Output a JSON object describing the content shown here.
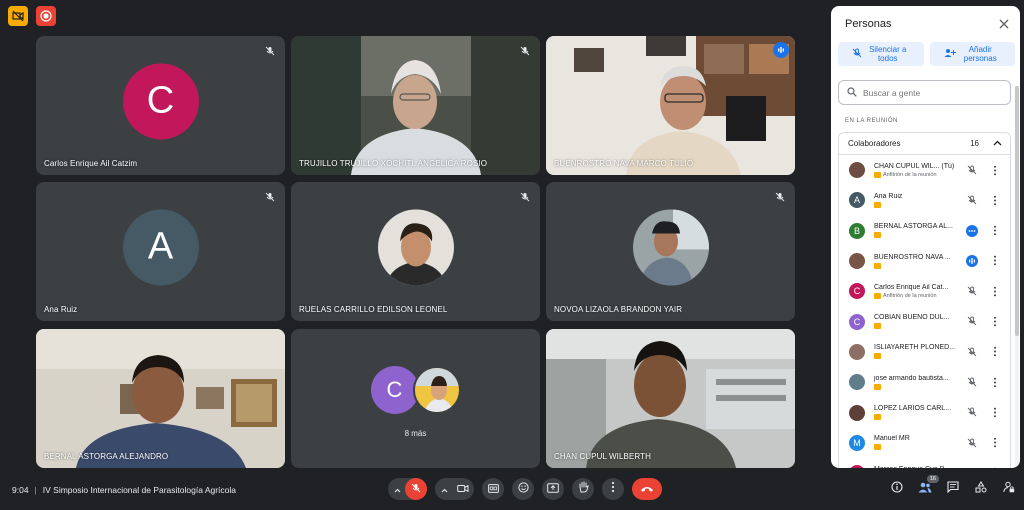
{
  "colors": {
    "accent": "#8ab4f8",
    "danger": "#ea4335",
    "panel_accent": "#1a73e8",
    "tile_bg": "#3c4043"
  },
  "tiles": [
    {
      "name": "Carlos Enrique Ail Catzim",
      "initial": "C",
      "avatar_color": "#c2185b"
    },
    {
      "name": "TRUJILLO TRUJILLO XOCHITL ANGELICA ROSIO"
    },
    {
      "name": "BUENROSTRO NAVA MARCO TULIO"
    },
    {
      "name": "Ana Ruiz",
      "initial": "A",
      "avatar_color": "#455a64"
    },
    {
      "name": "RUELAS CARRILLO EDILSON LEONEL"
    },
    {
      "name": "NOVOA LIZAOLA BRANDON YAIR"
    },
    {
      "name": "BERNAL ASTORGA ALEJANDRO"
    },
    {
      "more_initial": "C",
      "more_label": "8 más"
    },
    {
      "name": "CHAN CUPUL WILBERTH"
    }
  ],
  "panel": {
    "title": "Personas",
    "mute_all": "Silenciar a todos",
    "add_people": "Añadir personas",
    "search_placeholder": "Buscar a gente",
    "section": "EN LA REUNIÓN",
    "group_label": "Colaboradores",
    "group_count": "16",
    "people": [
      {
        "name": "CHAN CUPUL WIL... (Tú)",
        "sub": "Anfitrión de la reunión",
        "initial": "",
        "color": "#6d4c41",
        "status": "muted"
      },
      {
        "name": "Ana Ruiz",
        "sub": "",
        "initial": "A",
        "color": "#455a64",
        "status": "muted"
      },
      {
        "name": "BERNAL ASTORGA AL...",
        "sub": "",
        "initial": "B",
        "color": "#2e7d32",
        "status": "dots"
      },
      {
        "name": "BUENROSTRO NAVA ...",
        "sub": "",
        "initial": "",
        "color": "#795548",
        "status": "speaking"
      },
      {
        "name": "Carlos Enrique Ail Cat...",
        "sub": "Anfitrión de la reunión",
        "initial": "C",
        "color": "#c2185b",
        "status": "muted"
      },
      {
        "name": "COBIAN BUENO DUL...",
        "sub": "",
        "initial": "C",
        "color": "#8e63ce",
        "status": "muted"
      },
      {
        "name": "ISLIAYARETH PLONED...",
        "sub": "",
        "initial": "",
        "color": "#8d6e63",
        "status": "muted"
      },
      {
        "name": "jose armando bautista...",
        "sub": "",
        "initial": "",
        "color": "#607d8b",
        "status": "muted"
      },
      {
        "name": "LOPEZ LARIOS CARL...",
        "sub": "",
        "initial": "",
        "color": "#5d4037",
        "status": "muted"
      },
      {
        "name": "Manuel MR",
        "sub": "",
        "initial": "M",
        "color": "#1e88e5",
        "status": "muted"
      },
      {
        "name": "Marcos Enrique Cua B...",
        "sub": "",
        "initial": "M",
        "color": "#c2185b",
        "status": "muted"
      }
    ]
  },
  "bottom": {
    "time": "9:04",
    "separator": "|",
    "meeting_title": "IV Simposio Internacional de Parasitología Agrícola",
    "participants_count": "16"
  }
}
